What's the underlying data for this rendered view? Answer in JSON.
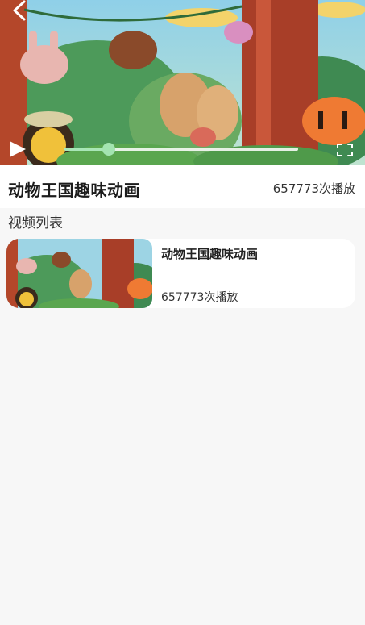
{
  "player": {
    "progress_percent": 19
  },
  "video": {
    "title": "动物王国趣味动画",
    "play_count": "657773次播放"
  },
  "playlist": {
    "section_title": "视频列表",
    "items": [
      {
        "title": "动物王国趣味动画",
        "play_count": "657773次播放"
      }
    ]
  },
  "icons": {
    "back": "chevron-left-icon",
    "play": "play-icon",
    "fullscreen": "fullscreen-icon"
  },
  "colors": {
    "progress_accent": "#a3e4b0",
    "background": "#f7f7f7"
  }
}
